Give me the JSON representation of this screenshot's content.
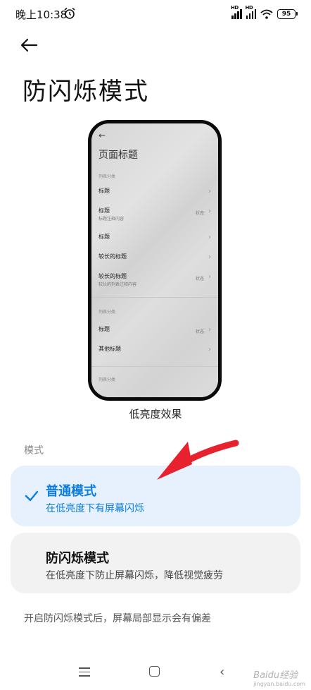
{
  "status_bar": {
    "time": "晚上10:38",
    "battery": "95",
    "network_badge": "HD"
  },
  "page": {
    "title": "防闪烁模式"
  },
  "preview": {
    "page_title": "页面标题",
    "categories": [
      "列表分类",
      "列表分类",
      "列表分类"
    ],
    "rows": [
      {
        "title": "标题",
        "subtitle": "",
        "status": ""
      },
      {
        "title": "标题",
        "subtitle": "标题注释内容",
        "status": "状态"
      },
      {
        "title": "标题",
        "subtitle": "",
        "status": ""
      },
      {
        "title": "较长的标题",
        "subtitle": "",
        "status": ""
      },
      {
        "title": "较长的标题",
        "subtitle": "较长的列表注释内容",
        "status": "状态"
      },
      {
        "title": "标题",
        "subtitle": "",
        "status": "状态"
      },
      {
        "title": "其他标题",
        "subtitle": "",
        "status": ""
      }
    ],
    "caption": "低亮度效果"
  },
  "modes": {
    "section_label": "模式",
    "options": [
      {
        "title": "普通模式",
        "description": "在低亮度下有屏幕闪烁",
        "selected": true
      },
      {
        "title": "防闪烁模式",
        "description": "在低亮度下防止屏幕闪烁，降低视觉疲劳",
        "selected": false
      }
    ],
    "selected_color": "#0d7de0"
  },
  "footer_note": "开启防闪烁模式后，屏幕局部显示会有偏差",
  "watermark": {
    "text": "Baidu经验",
    "sub": "jingyan.baidu.com"
  },
  "annotation_color": "#e8212e"
}
